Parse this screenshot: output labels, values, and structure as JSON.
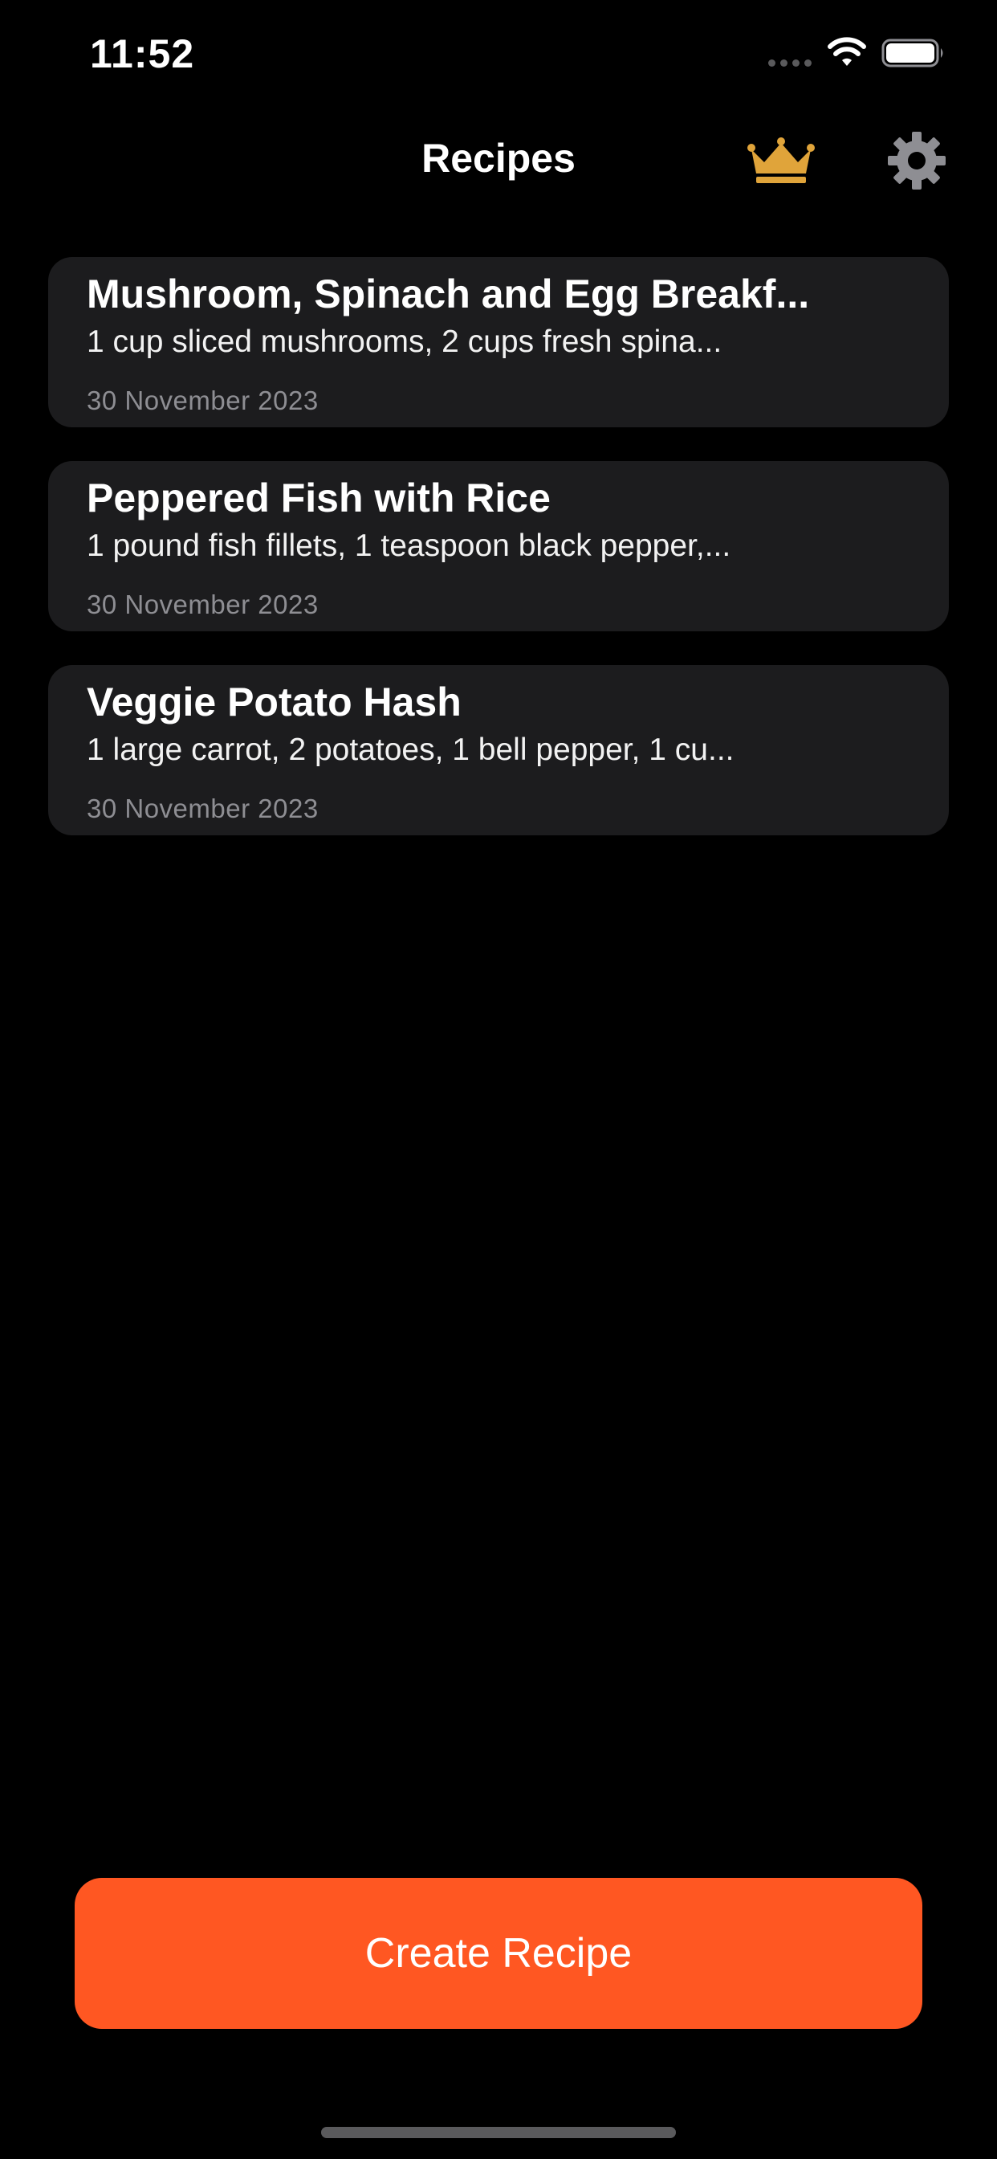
{
  "status_bar": {
    "time": "11:52"
  },
  "nav": {
    "title": "Recipes",
    "crown_color": "#e0a43a",
    "gear_color": "#8e8e93"
  },
  "recipes": [
    {
      "title": "Mushroom, Spinach and Egg Breakf...",
      "ingredients": "1 cup sliced mushrooms, 2 cups fresh spina...",
      "date": "30 November 2023"
    },
    {
      "title": "Peppered Fish with Rice",
      "ingredients": "1 pound fish fillets, 1 teaspoon black pepper,...",
      "date": "30 November 2023"
    },
    {
      "title": "Veggie Potato Hash",
      "ingredients": "1 large carrot, 2 potatoes, 1 bell pepper, 1 cu...",
      "date": "30 November 2023"
    }
  ],
  "create_button": {
    "label": "Create Recipe",
    "color": "#ff5722"
  }
}
